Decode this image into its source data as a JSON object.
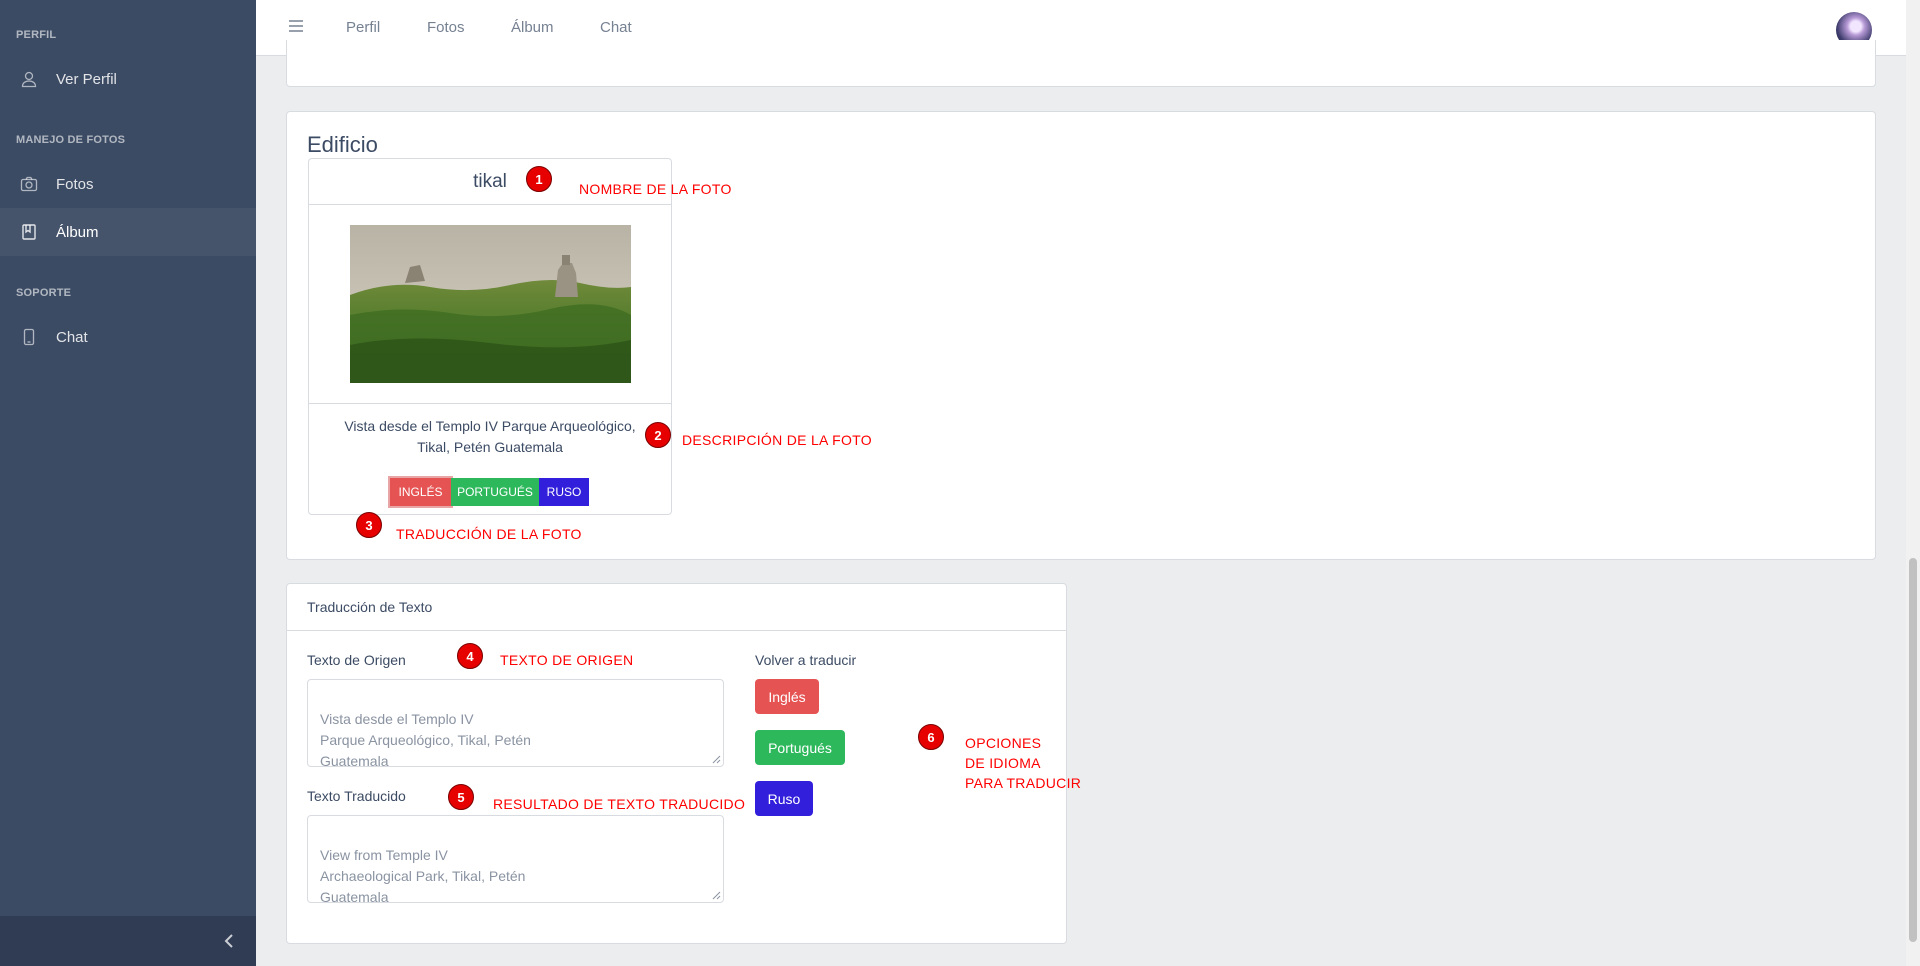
{
  "sidebar": {
    "sections": [
      {
        "title": "PERFIL",
        "items": [
          {
            "label": "Ver Perfil",
            "icon": "user-icon"
          }
        ]
      },
      {
        "title": "MANEJO DE FOTOS",
        "items": [
          {
            "label": "Fotos",
            "icon": "camera-icon"
          },
          {
            "label": "Álbum",
            "icon": "book-icon",
            "active": true
          }
        ]
      },
      {
        "title": "SOPORTE",
        "items": [
          {
            "label": "Chat",
            "icon": "phone-icon"
          }
        ]
      }
    ]
  },
  "header": {
    "nav": [
      "Perfil",
      "Fotos",
      "Álbum",
      "Chat"
    ]
  },
  "album": {
    "title": "Edificio",
    "photo": {
      "name": "tikal",
      "description": "Vista desde el Templo IV Parque Arqueológico, Tikal, Petén Guatemala",
      "buttons": [
        "INGLÉS",
        "PORTUGUÉS",
        "RUSO"
      ]
    }
  },
  "translation": {
    "title": "Traducción de Texto",
    "source_label": "Texto de Origen",
    "source_text": "Vista desde el Templo IV\nParque Arqueológico, Tikal, Petén\nGuatemala",
    "result_label": "Texto Traducido",
    "result_text": "View from Temple IV\nArchaeological Park, Tikal, Petén\nGuatemala",
    "retranslate_label": "Volver a traducir",
    "buttons": [
      "Inglés",
      "Portugués",
      "Ruso"
    ]
  },
  "annotations": [
    {
      "num": "1",
      "text": "NOMBRE DE LA FOTO"
    },
    {
      "num": "2",
      "text": "DESCRIPCIÓN DE LA FOTO"
    },
    {
      "num": "3",
      "text": "TRADUCCIÓN DE LA FOTO"
    },
    {
      "num": "4",
      "text": "TEXTO DE ORIGEN"
    },
    {
      "num": "5",
      "text": "RESULTADO DE TEXTO TRADUCIDO"
    },
    {
      "num": "6",
      "text": "OPCIONES\nDE IDIOMA\nPARA TRADUCIR"
    }
  ],
  "colors": {
    "sidebar": "#3c4b64",
    "danger": "#e55353",
    "success": "#2eb85c",
    "ruso": "#321fdb",
    "annotation": "#ff0000"
  }
}
